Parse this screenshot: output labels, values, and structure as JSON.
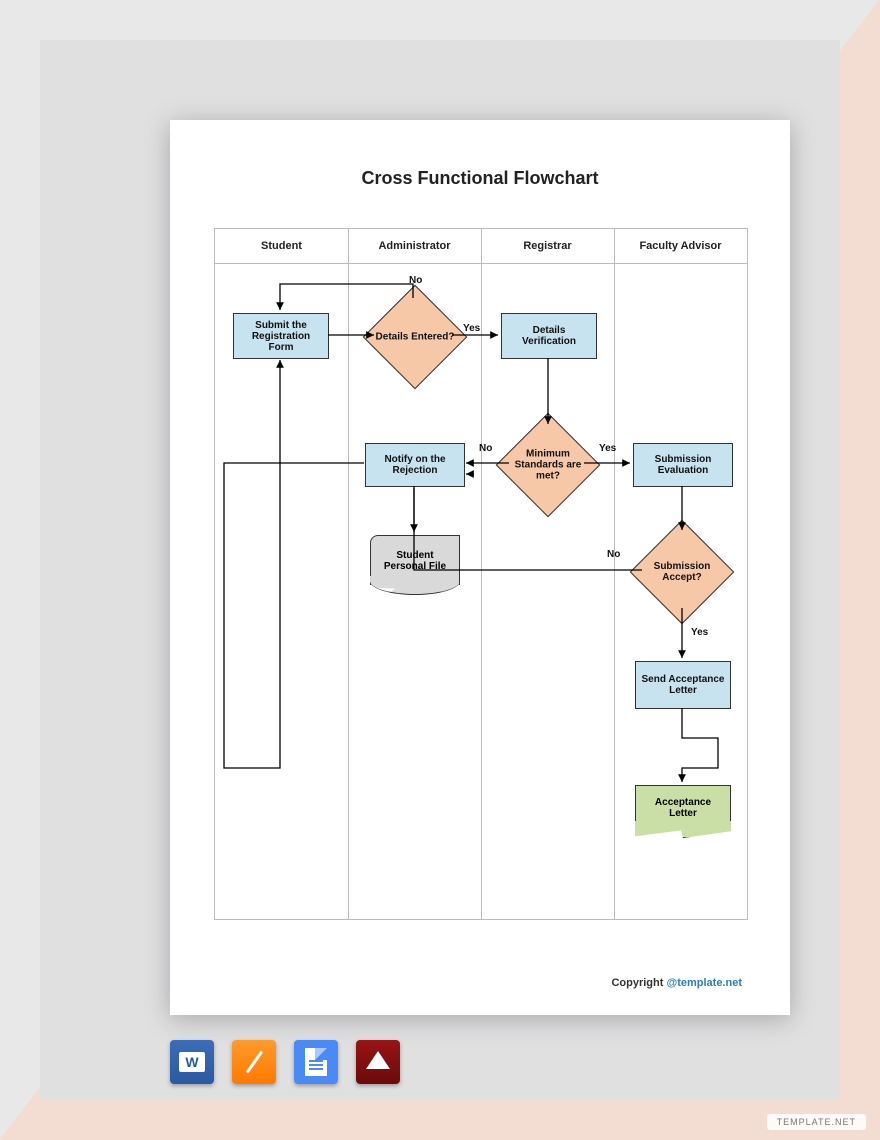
{
  "title": "Cross Functional Flowchart",
  "lanes": {
    "c1": "Student",
    "c2": "Administrator",
    "c3": "Registrar",
    "c4": "Faculty Advisor"
  },
  "nodes": {
    "submit": "Submit the Registration Form",
    "detailsEntered": "Details Entered?",
    "detailsVerification": "Details Verification",
    "notify": "Notify on the Rejection",
    "standards": "Minimum Standards are met?",
    "evaluation": "Submission Evaluation",
    "studentFile": "Student Personal File",
    "submissionAccept": "Submission Accept?",
    "sendLetter": "Send Acceptance Letter",
    "acceptanceLetter": "Acceptance Letter"
  },
  "edges": {
    "no": "No",
    "yes": "Yes"
  },
  "copyright": {
    "text": "Copyright ",
    "link": "@template.net"
  },
  "watermark": "TEMPLATE.NET",
  "icons": {
    "word": "W"
  }
}
